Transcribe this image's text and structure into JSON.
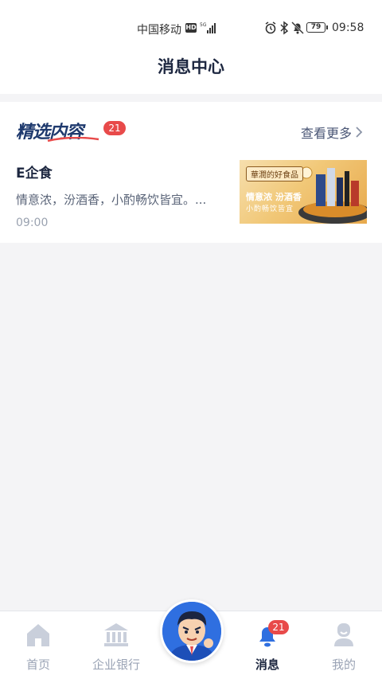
{
  "status_bar": {
    "carrier": "中国移动",
    "hd": "HD",
    "network": "5G",
    "battery": "79",
    "time": "09:58"
  },
  "header": {
    "title": "消息中心"
  },
  "section": {
    "logo_text": "精选内容",
    "badge": "21",
    "see_more": "查看更多"
  },
  "message": {
    "title": "E企食",
    "description": "情意浓，汾酒香，小酌畅饮皆宜。...",
    "time": "09:00",
    "thumbnail": {
      "label": "華潤的好食品",
      "line1": "情意浓 汾酒香",
      "line2": "小酌畅饮皆宜"
    }
  },
  "bottom_nav": {
    "items": [
      {
        "label": "首页",
        "icon": "home-icon"
      },
      {
        "label": "企业银行",
        "icon": "bank-icon"
      },
      {
        "label": "消息",
        "icon": "bell-icon",
        "badge": "21",
        "active": true
      },
      {
        "label": "我的",
        "icon": "user-icon"
      }
    ],
    "center_icon": "mascot-avatar"
  },
  "colors": {
    "accent": "#1d2740",
    "badge": "#e84a4a",
    "inactive": "#9aa3b5",
    "active_icon": "#2f6fe0"
  }
}
